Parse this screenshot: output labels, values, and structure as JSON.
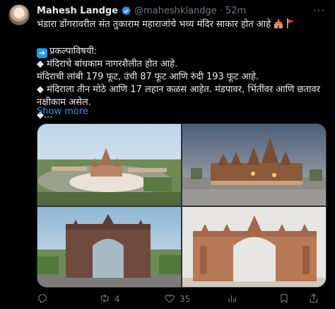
{
  "tweet": {
    "author_name": "Mahesh Landge",
    "handle": "@maheshklandge",
    "separator": "·",
    "time": "52m",
    "lines": [
      "भंडारा डोंगरावरील संत तुकाराम महाराजांचे भव्य मंदिर साकार होत आहे",
      "",
      "प्रकल्पाविषयी:",
      "◆ मंदिराचे बांधकाम नागरशैलीत होत आहे.",
      "मंदिराची लांबी 179 फूट, उंची 87 फूट आणि रुंदी 193 फूट आहे.",
      "◆ मंदिराला तीन मोठे आणि 17 लहान कळस आहेत. मंडपावर, भिंतींवर आणि छतावर",
      "नक्षीकाम असेल.",
      "◆..."
    ],
    "show_more": "Show more"
  },
  "actions": {
    "reply_count": "",
    "retweet_count": "4",
    "like_count": "35",
    "views_count": ""
  },
  "icons": [
    "verified-badge-icon",
    "more-options-icon",
    "temple-emoji-icon",
    "flag-emoji-icon",
    "right-arrow-emoji-icon",
    "reply-icon",
    "retweet-icon",
    "like-icon",
    "views-icon",
    "bookmark-icon",
    "share-icon"
  ],
  "colors": {
    "accent": "#1d9bf0",
    "muted": "#71767b",
    "text": "#e7e9ea",
    "background": "#000000"
  }
}
